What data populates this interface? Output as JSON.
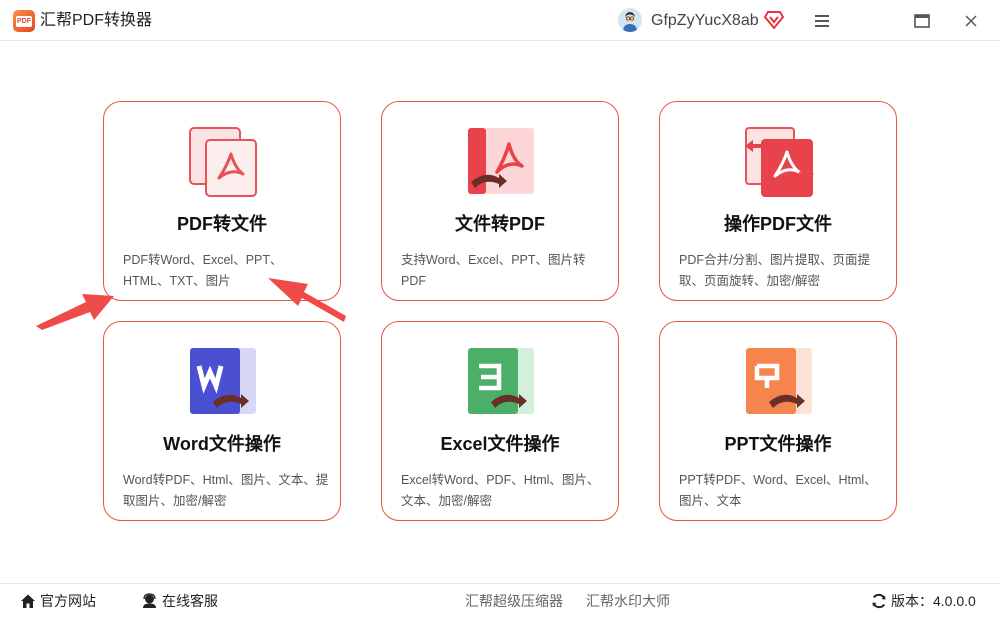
{
  "window": {
    "title": "汇帮PDF转换器",
    "logo_text": "PDF",
    "username": "GfpZyYucX8ab"
  },
  "cards": [
    {
      "title": "PDF转文件",
      "desc": "PDF转Word、Excel、PPT、HTML、TXT、图片",
      "icon": "pdf-to-file-icon"
    },
    {
      "title": "文件转PDF",
      "desc": "支持Word、Excel、PPT、图片转PDF",
      "icon": "file-to-pdf-icon"
    },
    {
      "title": "操作PDF文件",
      "desc": "PDF合并/分割、图片提取、页面提取、页面旋转、加密/解密",
      "icon": "pdf-operate-icon"
    },
    {
      "title": "Word文件操作",
      "desc": "Word转PDF、Html、图片、文本、提取图片、加密/解密",
      "icon": "word-icon"
    },
    {
      "title": "Excel文件操作",
      "desc": "Excel转Word、PDF、Html、图片、文本、加密/解密",
      "icon": "excel-icon"
    },
    {
      "title": "PPT文件操作",
      "desc": "PPT转PDF、Word、Excel、Html、图片、文本",
      "icon": "ppt-icon"
    }
  ],
  "footer": {
    "website": "官方网站",
    "support": "在线客服",
    "compressor": "汇帮超级压缩器",
    "watermark": "汇帮水印大师",
    "version": "版本：4.0.0.0"
  },
  "colors": {
    "accent": "#e8553d",
    "pdf_red": "#e8525a",
    "word_blue": "#4b4fd1",
    "excel_green": "#4caf68",
    "ppt_orange": "#f5844d"
  }
}
